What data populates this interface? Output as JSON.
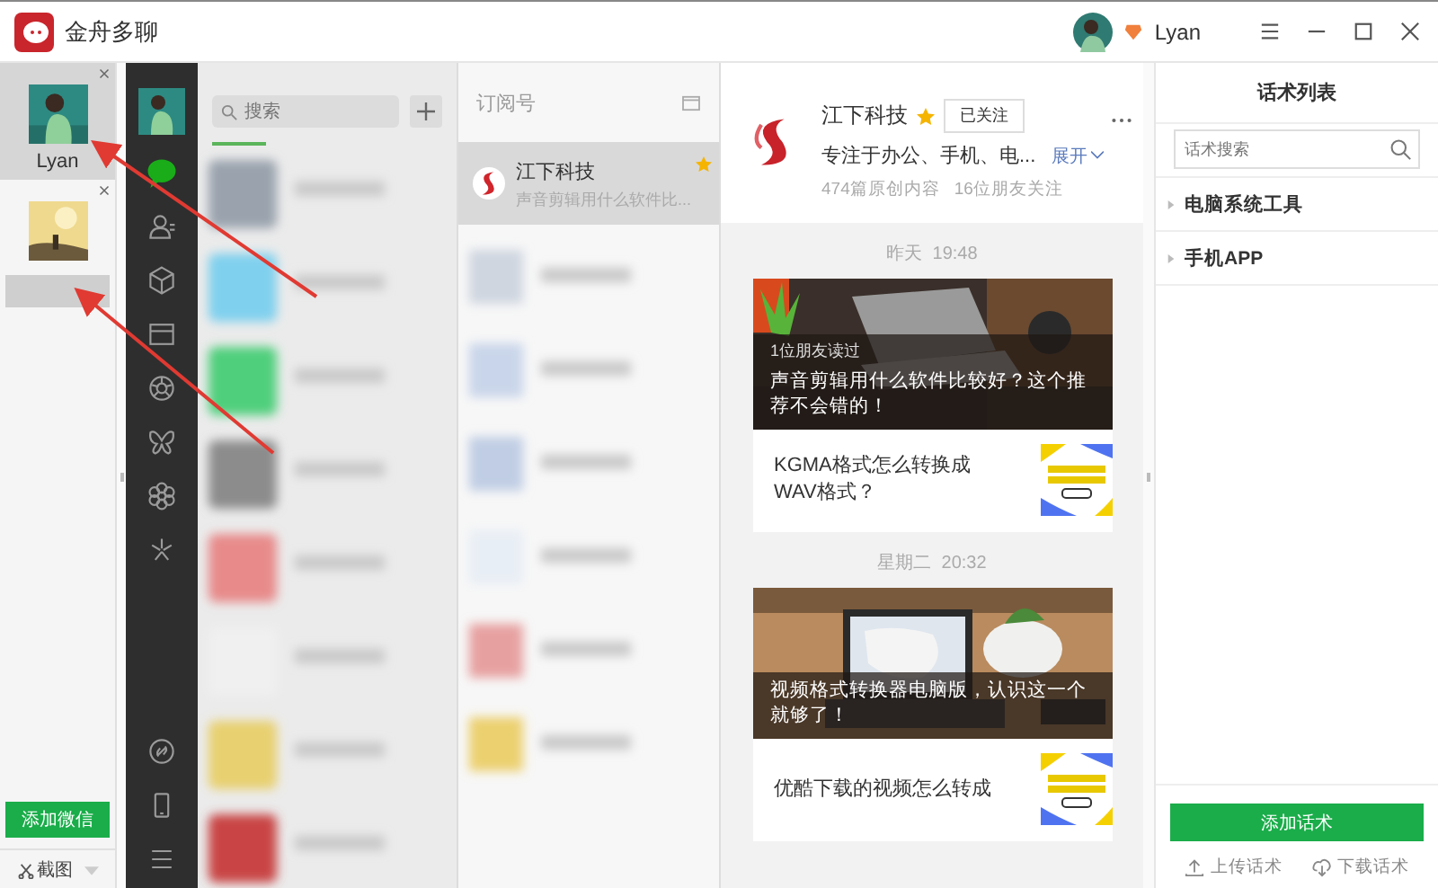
{
  "window": {
    "title": "金舟多聊",
    "user": "Lyan"
  },
  "accounts": [
    {
      "name": "Lyan",
      "selected": true
    },
    {
      "selected": false
    }
  ],
  "add_account_button": "添加微信",
  "screenshot_button": "截图",
  "nav": {
    "top": [
      {
        "kind": "chat",
        "selected": true
      },
      {
        "kind": "contacts",
        "selected": false
      },
      {
        "kind": "cube",
        "selected": false
      },
      {
        "kind": "folder",
        "selected": false
      },
      {
        "kind": "aperture",
        "selected": false
      },
      {
        "kind": "butterfly",
        "selected": false
      },
      {
        "kind": "flower",
        "selected": false
      },
      {
        "kind": "sparkle",
        "selected": false
      }
    ],
    "bottom": [
      {
        "kind": "link",
        "selected": false
      },
      {
        "kind": "phone",
        "selected": false
      },
      {
        "kind": "menu",
        "selected": false
      }
    ]
  },
  "chat_list": {
    "search": {
      "placeholder": "搜索"
    }
  },
  "subscriptions": {
    "title": "订阅号",
    "items": [
      {
        "name": "江下科技",
        "preview": "声音剪辑用什么软件比...",
        "starred": true,
        "selected": true
      }
    ]
  },
  "profile": {
    "name": "江下科技",
    "starred": true,
    "follow_button": "已关注",
    "description": "专注于办公、手机、电...",
    "expand": "展开",
    "stats": [
      "474篇原创内容",
      "16位朋友关注"
    ]
  },
  "feed": [
    {
      "time": "昨天  19:48",
      "cover": {
        "note": "1位朋友读过",
        "title": "声音剪辑用什么软件比较好？这个推荐不会错的！",
        "kind": "desk"
      },
      "items": [
        {
          "title": "KGMA格式怎么转换成WAV格式？"
        }
      ]
    },
    {
      "time": "星期二  20:32",
      "cover": {
        "title": "视频格式转换器电脑版，认识这一个就够了！",
        "kind": "table"
      },
      "items": [
        {
          "title": "优酷下载的视频怎么转成"
        }
      ]
    }
  ],
  "scripts_panel": {
    "title": "话术列表",
    "search": {
      "placeholder": "话术搜索"
    },
    "categories": [
      {
        "name": "电脑系统工具",
        "expanded": false
      },
      {
        "name": "手机APP",
        "expanded": false
      }
    ],
    "add_button": "添加话术",
    "upload": "上传话术",
    "download": "下载话术"
  }
}
